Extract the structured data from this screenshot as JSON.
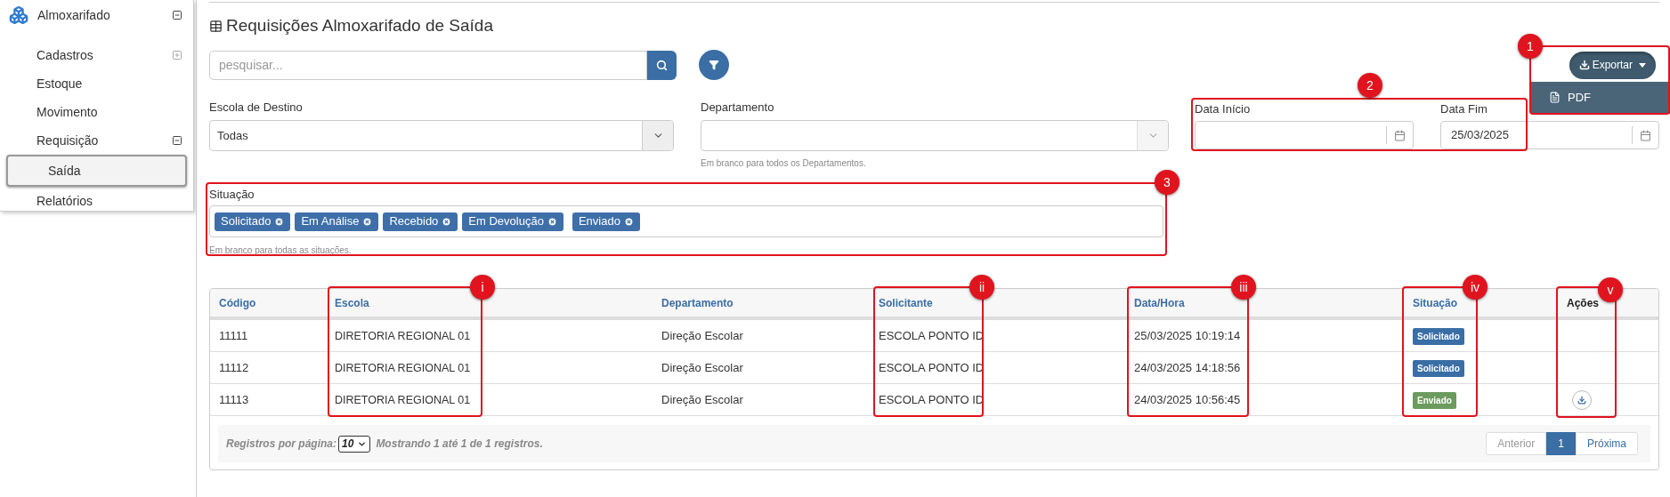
{
  "sidebar": {
    "title": {
      "label": "Almoxarifado",
      "expanded": true
    },
    "items": [
      {
        "label": "Cadastros",
        "expanded": false,
        "selected": false
      },
      {
        "label": "Estoque",
        "selected": false
      },
      {
        "label": "Movimento",
        "selected": false
      },
      {
        "label": "Requisição",
        "expanded": true,
        "selected": false,
        "children": [
          {
            "label": "Saída",
            "selected": true
          }
        ]
      },
      {
        "label": "Relatórios",
        "selected": false
      }
    ]
  },
  "page_title": "Requisições Almoxarifado de Saída",
  "search": {
    "placeholder": "pesquisar..."
  },
  "export": {
    "label": "Exportar",
    "expanded": true,
    "menu": [
      "PDF"
    ]
  },
  "filters": {
    "escola": {
      "label": "Escola de Destino",
      "value": "Todas"
    },
    "departamento": {
      "label": "Departamento",
      "help": "Em branco para todos os Departamentos."
    },
    "data_inicio": {
      "label": "Data Início"
    },
    "data_fim": {
      "label": "Data Fim",
      "value": "25/03/2025"
    },
    "situacao": {
      "label": "Situação",
      "tags": [
        "Solicitado",
        "Em Análise",
        "Recebido",
        "Em Devolução",
        "Enviado"
      ],
      "help": "Em branco para todas as situações."
    }
  },
  "table": {
    "columns": [
      "Código",
      "Escola",
      "Departamento",
      "Solicitante",
      "Data/Hora",
      "Situação",
      "Ações"
    ],
    "rows": [
      {
        "codigo": "11111",
        "escola": "DIRETORIA REGIONAL 01",
        "departamento": "Direção Escolar",
        "solicitante": "ESCOLA PONTO ID",
        "data": "25/03/2025 10:19:14",
        "situacao": {
          "label": "Solicitado",
          "color": "#3a6ea5"
        }
      },
      {
        "codigo": "11112",
        "escola": "DIRETORIA REGIONAL 01",
        "departamento": "Direção Escolar",
        "solicitante": "ESCOLA PONTO ID",
        "data": "24/03/2025 14:18:56",
        "situacao": {
          "label": "Solicitado",
          "color": "#3a6ea5"
        }
      },
      {
        "codigo": "11113",
        "escola": "DIRETORIA REGIONAL 01",
        "departamento": "Direção Escolar",
        "solicitante": "ESCOLA PONTO ID",
        "data": "24/03/2025 10:56:45",
        "situacao": {
          "label": "Enviado",
          "color": "#6b9b5e"
        },
        "actions": [
          {
            "kind": "download"
          }
        ]
      }
    ],
    "footer": {
      "per_page_label": "Registros por página:",
      "per_page": "10",
      "summary": "Mostrando **1** até **1** de **1** registros."
    },
    "pagination": [
      {
        "label": "Anterior",
        "disabled": true,
        "selected": false
      },
      {
        "label": "1",
        "disabled": false,
        "selected": true
      },
      {
        "label": "Próxima",
        "disabled": false,
        "selected": false
      }
    ]
  },
  "annotations": [
    {
      "label": "1"
    },
    {
      "label": "2"
    },
    {
      "label": "3"
    },
    {
      "label": "i"
    },
    {
      "label": "ii"
    },
    {
      "label": "iii"
    },
    {
      "label": "iv"
    },
    {
      "label": "v"
    }
  ]
}
